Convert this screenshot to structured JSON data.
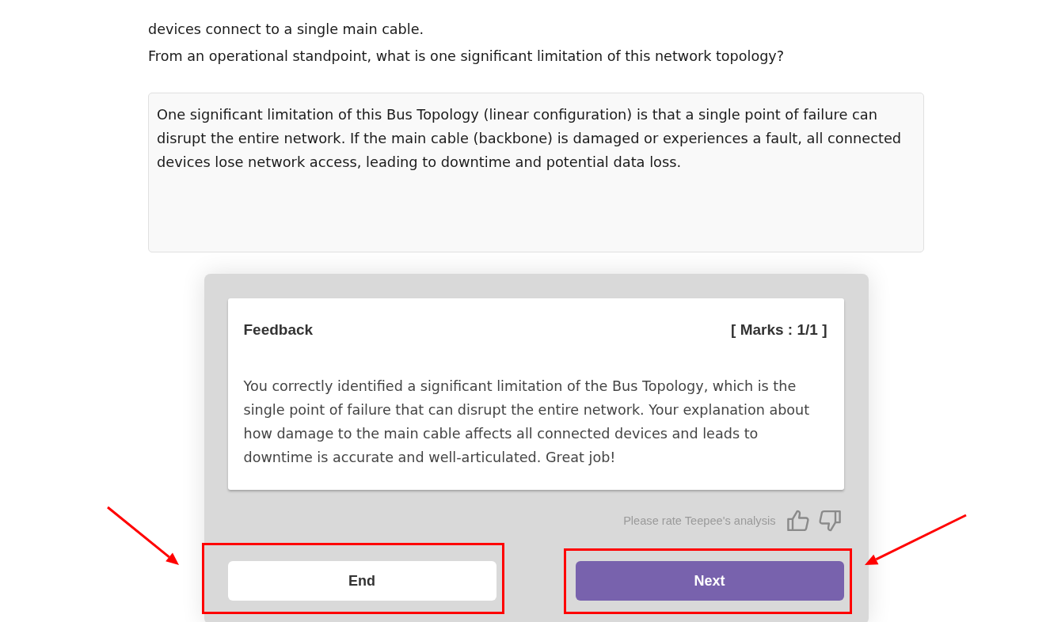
{
  "question": {
    "context": "devices connect to a single main cable.",
    "prompt": "From an operational standpoint, what is one significant limitation of this network topology?"
  },
  "answer": {
    "value": "One significant limitation of this Bus Topology (linear configuration) is that a single point of failure can disrupt the entire network. If the main cable (backbone) is damaged or experiences a fault, all connected devices lose network access, leading to downtime and potential data loss."
  },
  "feedback": {
    "title": "Feedback",
    "marks": "[ Marks : 1/1 ]",
    "body": "You correctly identified a significant limitation of the Bus Topology, which is the single point of failure that can disrupt the entire network. Your explanation about how damage to the main cable affects all connected devices and leads to downtime is accurate and well-articulated. Great job!"
  },
  "rating": {
    "prompt": "Please rate Teepee's analysis"
  },
  "buttons": [
    {
      "label": "End",
      "kind": "secondary",
      "highlighted": true
    },
    {
      "label": "Next",
      "kind": "primary",
      "highlighted": true
    }
  ]
}
